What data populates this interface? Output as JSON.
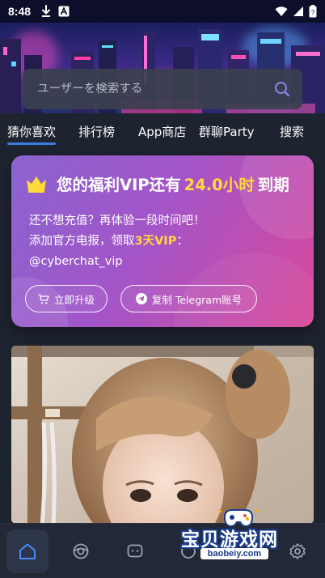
{
  "status_bar": {
    "time": "8:48",
    "left_icons": [
      "download-icon",
      "a-box-icon"
    ],
    "right_icons": [
      "wifi-icon",
      "signal-icon",
      "battery-icon"
    ]
  },
  "search": {
    "placeholder": "ユーザーを検索する",
    "icon": "search-icon"
  },
  "tabs": [
    {
      "label": "猜你喜欢",
      "active": true
    },
    {
      "label": "排行榜",
      "active": false
    },
    {
      "label": "App商店",
      "active": false
    },
    {
      "label": "群聊Party",
      "active": false
    },
    {
      "label": "搜索",
      "active": false
    }
  ],
  "vip_card": {
    "title_prefix": "您的福利VIP还有",
    "hours_left": "24.0小时",
    "title_suffix": "到期",
    "line1": "还不想充值？再体验一段时间吧！",
    "line2_prefix": "添加官方电报，领取",
    "line2_highlight": "3天VIP",
    "line2_suffix": "：",
    "line3": "@cyberchat_vip",
    "upgrade_button": "立即升级",
    "copy_telegram_button": "复制 Telegram账号",
    "highlight_color": "#ffd93a",
    "gradient": [
      "#8a63d0",
      "#d9489a"
    ]
  },
  "bottom_nav": {
    "items": [
      {
        "icon": "home-icon",
        "active": true
      },
      {
        "icon": "eye-icon",
        "active": false
      },
      {
        "icon": "chat-icon",
        "active": false
      },
      {
        "icon": "community-icon",
        "active": false
      },
      {
        "icon": "settings-icon",
        "active": false
      }
    ],
    "active_color": "#4a8cff"
  },
  "watermark": {
    "text": "宝贝游戏网",
    "domain": "baobeiy.com"
  }
}
